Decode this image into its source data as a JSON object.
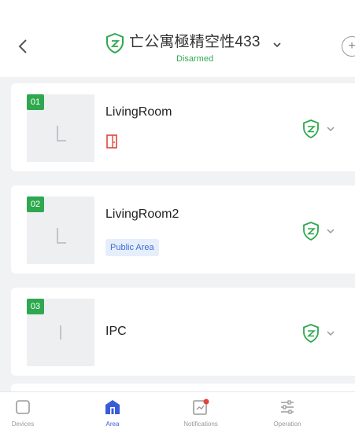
{
  "header": {
    "title": "亡公寓極精空性433",
    "status": "Disarmed",
    "status_color": "#33a853"
  },
  "icons": {
    "back": "chevron-left-icon",
    "title_shield": "shield-icon",
    "title_dropdown": "chevron-down-icon",
    "add": "add-circle-icon",
    "door": "door-icon"
  },
  "areas": [
    {
      "index": "01",
      "name": "LivingRoom",
      "tag": "",
      "has_door_icon": true
    },
    {
      "index": "02",
      "name": "LivingRoom2",
      "tag": "Public Area",
      "has_door_icon": false
    },
    {
      "index": "03",
      "name": "IPC",
      "tag": "",
      "has_door_icon": false
    }
  ],
  "nav": [
    {
      "label": "Devices",
      "icon": "devices-icon",
      "active": false
    },
    {
      "label": "Area",
      "icon": "area-home-icon",
      "active": true
    },
    {
      "label": "Notifications",
      "icon": "notifications-icon",
      "active": false
    },
    {
      "label": "Operation",
      "icon": "operation-sliders-icon",
      "active": false
    }
  ],
  "colors": {
    "accent_green": "#2ea84e",
    "accent_blue": "#3a5bd9",
    "tag_blue": "#3b6fd4",
    "alert_red": "#e0463f"
  }
}
